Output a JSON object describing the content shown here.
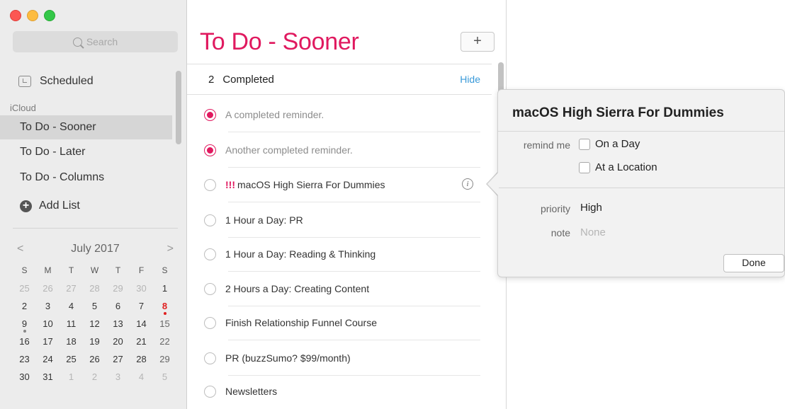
{
  "sidebar": {
    "search_placeholder": "Search",
    "scheduled_label": "Scheduled",
    "group_label": "iCloud",
    "lists": [
      {
        "label": "To Do - Sooner",
        "selected": true
      },
      {
        "label": "To Do - Later",
        "selected": false
      },
      {
        "label": "To Do - Columns",
        "selected": false
      }
    ],
    "add_list_label": "Add List"
  },
  "calendar": {
    "month_label": "July 2017",
    "prev_glyph": "<",
    "next_glyph": ">",
    "weekdays": [
      "S",
      "M",
      "T",
      "W",
      "T",
      "F",
      "S"
    ],
    "weeks": [
      [
        "25",
        "26",
        "27",
        "28",
        "29",
        "30",
        "1"
      ],
      [
        "2",
        "3",
        "4",
        "5",
        "6",
        "7",
        "8"
      ],
      [
        "9",
        "10",
        "11",
        "12",
        "13",
        "14",
        "15"
      ],
      [
        "16",
        "17",
        "18",
        "19",
        "20",
        "21",
        "22"
      ],
      [
        "23",
        "24",
        "25",
        "26",
        "27",
        "28",
        "29"
      ],
      [
        "30",
        "31",
        "1",
        "2",
        "3",
        "4",
        "5"
      ]
    ],
    "today": "8"
  },
  "main": {
    "title": "To Do - Sooner",
    "add_button": "+",
    "completed_count": "2",
    "completed_label": "Completed",
    "hide_label": "Hide",
    "completed_items": [
      {
        "text": "A completed reminder."
      },
      {
        "text": "Another completed reminder."
      }
    ],
    "items": [
      {
        "priority": "!!!",
        "text": "macOS High Sierra For Dummies",
        "info": "i"
      },
      {
        "priority": "",
        "text": "1 Hour a Day: PR"
      },
      {
        "priority": "",
        "text": "1 Hour a Day: Reading & Thinking"
      },
      {
        "priority": "",
        "text": "2 Hours a Day: Creating Content"
      },
      {
        "priority": "",
        "text": "Finish Relationship Funnel Course"
      },
      {
        "priority": "",
        "text": "PR (buzzSumo? $99/month)"
      },
      {
        "priority": "",
        "text": "Newsletters"
      }
    ]
  },
  "popover": {
    "title": "macOS High Sierra For Dummies",
    "remind_label": "remind me",
    "on_day_label": "On a Day",
    "at_location_label": "At a Location",
    "priority_label": "priority",
    "priority_value": "High",
    "note_label": "note",
    "note_value": "None",
    "done_label": "Done"
  },
  "colors": {
    "accent": "#e0195f",
    "link": "#3a9ad9"
  }
}
